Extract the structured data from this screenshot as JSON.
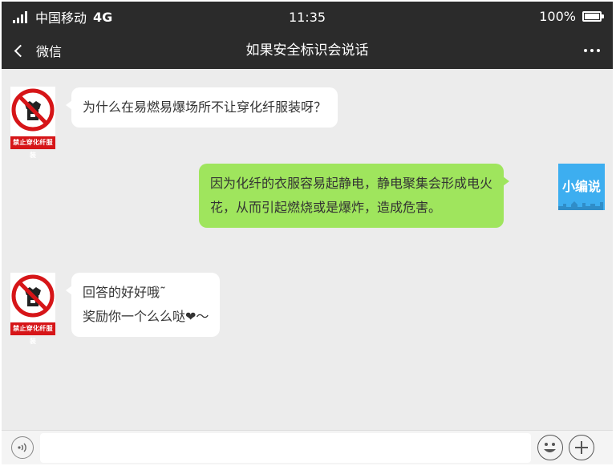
{
  "status_bar": {
    "carrier": "中国移动",
    "network": "4G",
    "time": "11:35",
    "battery": "100%"
  },
  "nav": {
    "back_label": "微信",
    "title": "如果安全标识会说话",
    "icons": {
      "back": "chevron-left-icon",
      "more": "more-dots-icon"
    }
  },
  "messages": [
    {
      "side": "in",
      "sender": "禁止穿化纤服装",
      "lines": [
        "为什么在易燃易爆场所不让穿化纤服装呀？"
      ]
    },
    {
      "side": "out",
      "sender": "小编说",
      "lines": [
        "因为化纤的衣服容易起静电，静电聚集会形成电火",
        "花，从而引起燃烧或是爆炸，造成危害。"
      ]
    },
    {
      "side": "in",
      "sender": "禁止穿化纤服装",
      "lines": [
        "回答的好好哦˜",
        "奖励你一个么么哒❤～"
      ]
    }
  ],
  "avatars": {
    "sign_caption": "禁止穿化纤服装",
    "editor_label": "小编说"
  },
  "colors": {
    "header": "#2b2b2b",
    "chat_background": "#ececec",
    "outgoing_bubble": "#9fe55d",
    "incoming_bubble": "#ffffff",
    "sign_red": "#d61518",
    "editor_avatar": "#3daef0"
  },
  "input_bar": {
    "icons": {
      "voice": "voice-icon",
      "emoji": "emoji-icon",
      "more": "plus-icon"
    }
  }
}
